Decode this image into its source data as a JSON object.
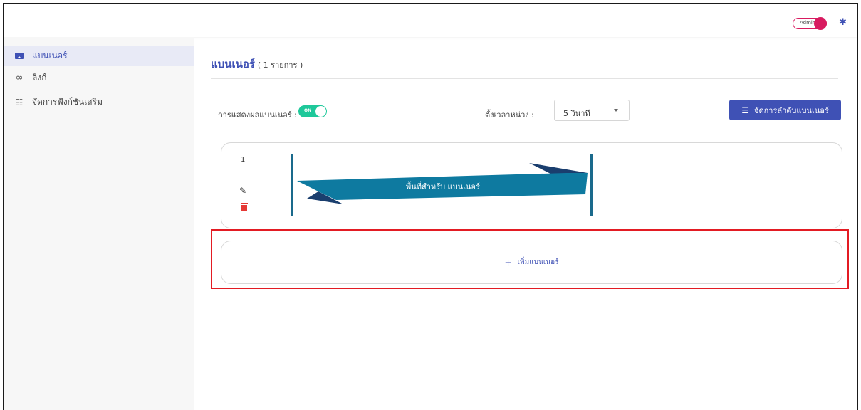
{
  "header": {
    "admin_label": "Admin",
    "gear_icon": "gear-icon"
  },
  "sidebar": {
    "items": [
      {
        "label": "แบนเนอร์",
        "icon": "image-icon",
        "active": true
      },
      {
        "label": "ลิงก์",
        "icon": "link-icon",
        "active": false
      },
      {
        "label": "จัดการฟังก์ชันเสริม",
        "icon": "sliders-icon",
        "active": false
      }
    ]
  },
  "main": {
    "title": "แบนเนอร์",
    "count": "( 1 รายการ )",
    "display_label": "การแสดงผลแบนเนอร์ :",
    "display_toggle": "ON",
    "delay_label": "ตั้งเวลาหน่วง :",
    "delay_value": "5 วินาที",
    "manage_button": "จัดการลำดับแบนเนอร์",
    "banners": [
      {
        "index": "1",
        "placeholder_text": "พื้นที่สำหรับ แบนเนอร์"
      }
    ],
    "add_banner": "เพิ่มแบนเนอร์"
  },
  "colors": {
    "accent": "#3f51b5",
    "toggle_on": "#1ec89a",
    "admin": "#d81b60",
    "highlight": "#e31b23",
    "banner": "#0e7aa0",
    "banner_dark": "#1a3e6e"
  }
}
